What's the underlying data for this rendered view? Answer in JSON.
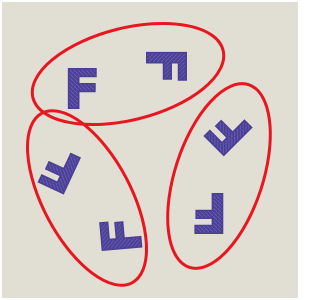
{
  "canvas": {
    "background_color": "#ffffff",
    "fabric_color": "#e1dfd3",
    "thread_color": "#4a3f95",
    "ellipse_color": "#e81620"
  },
  "letters": [
    {
      "text": "F",
      "cluster": "top"
    },
    {
      "text": "F",
      "cluster": "top"
    },
    {
      "text": "F",
      "cluster": "right"
    },
    {
      "text": "F",
      "cluster": "right"
    },
    {
      "text": "F",
      "cluster": "left"
    },
    {
      "text": "F",
      "cluster": "left"
    }
  ],
  "groups": [
    {
      "name": "top"
    },
    {
      "name": "right"
    },
    {
      "name": "left"
    }
  ]
}
